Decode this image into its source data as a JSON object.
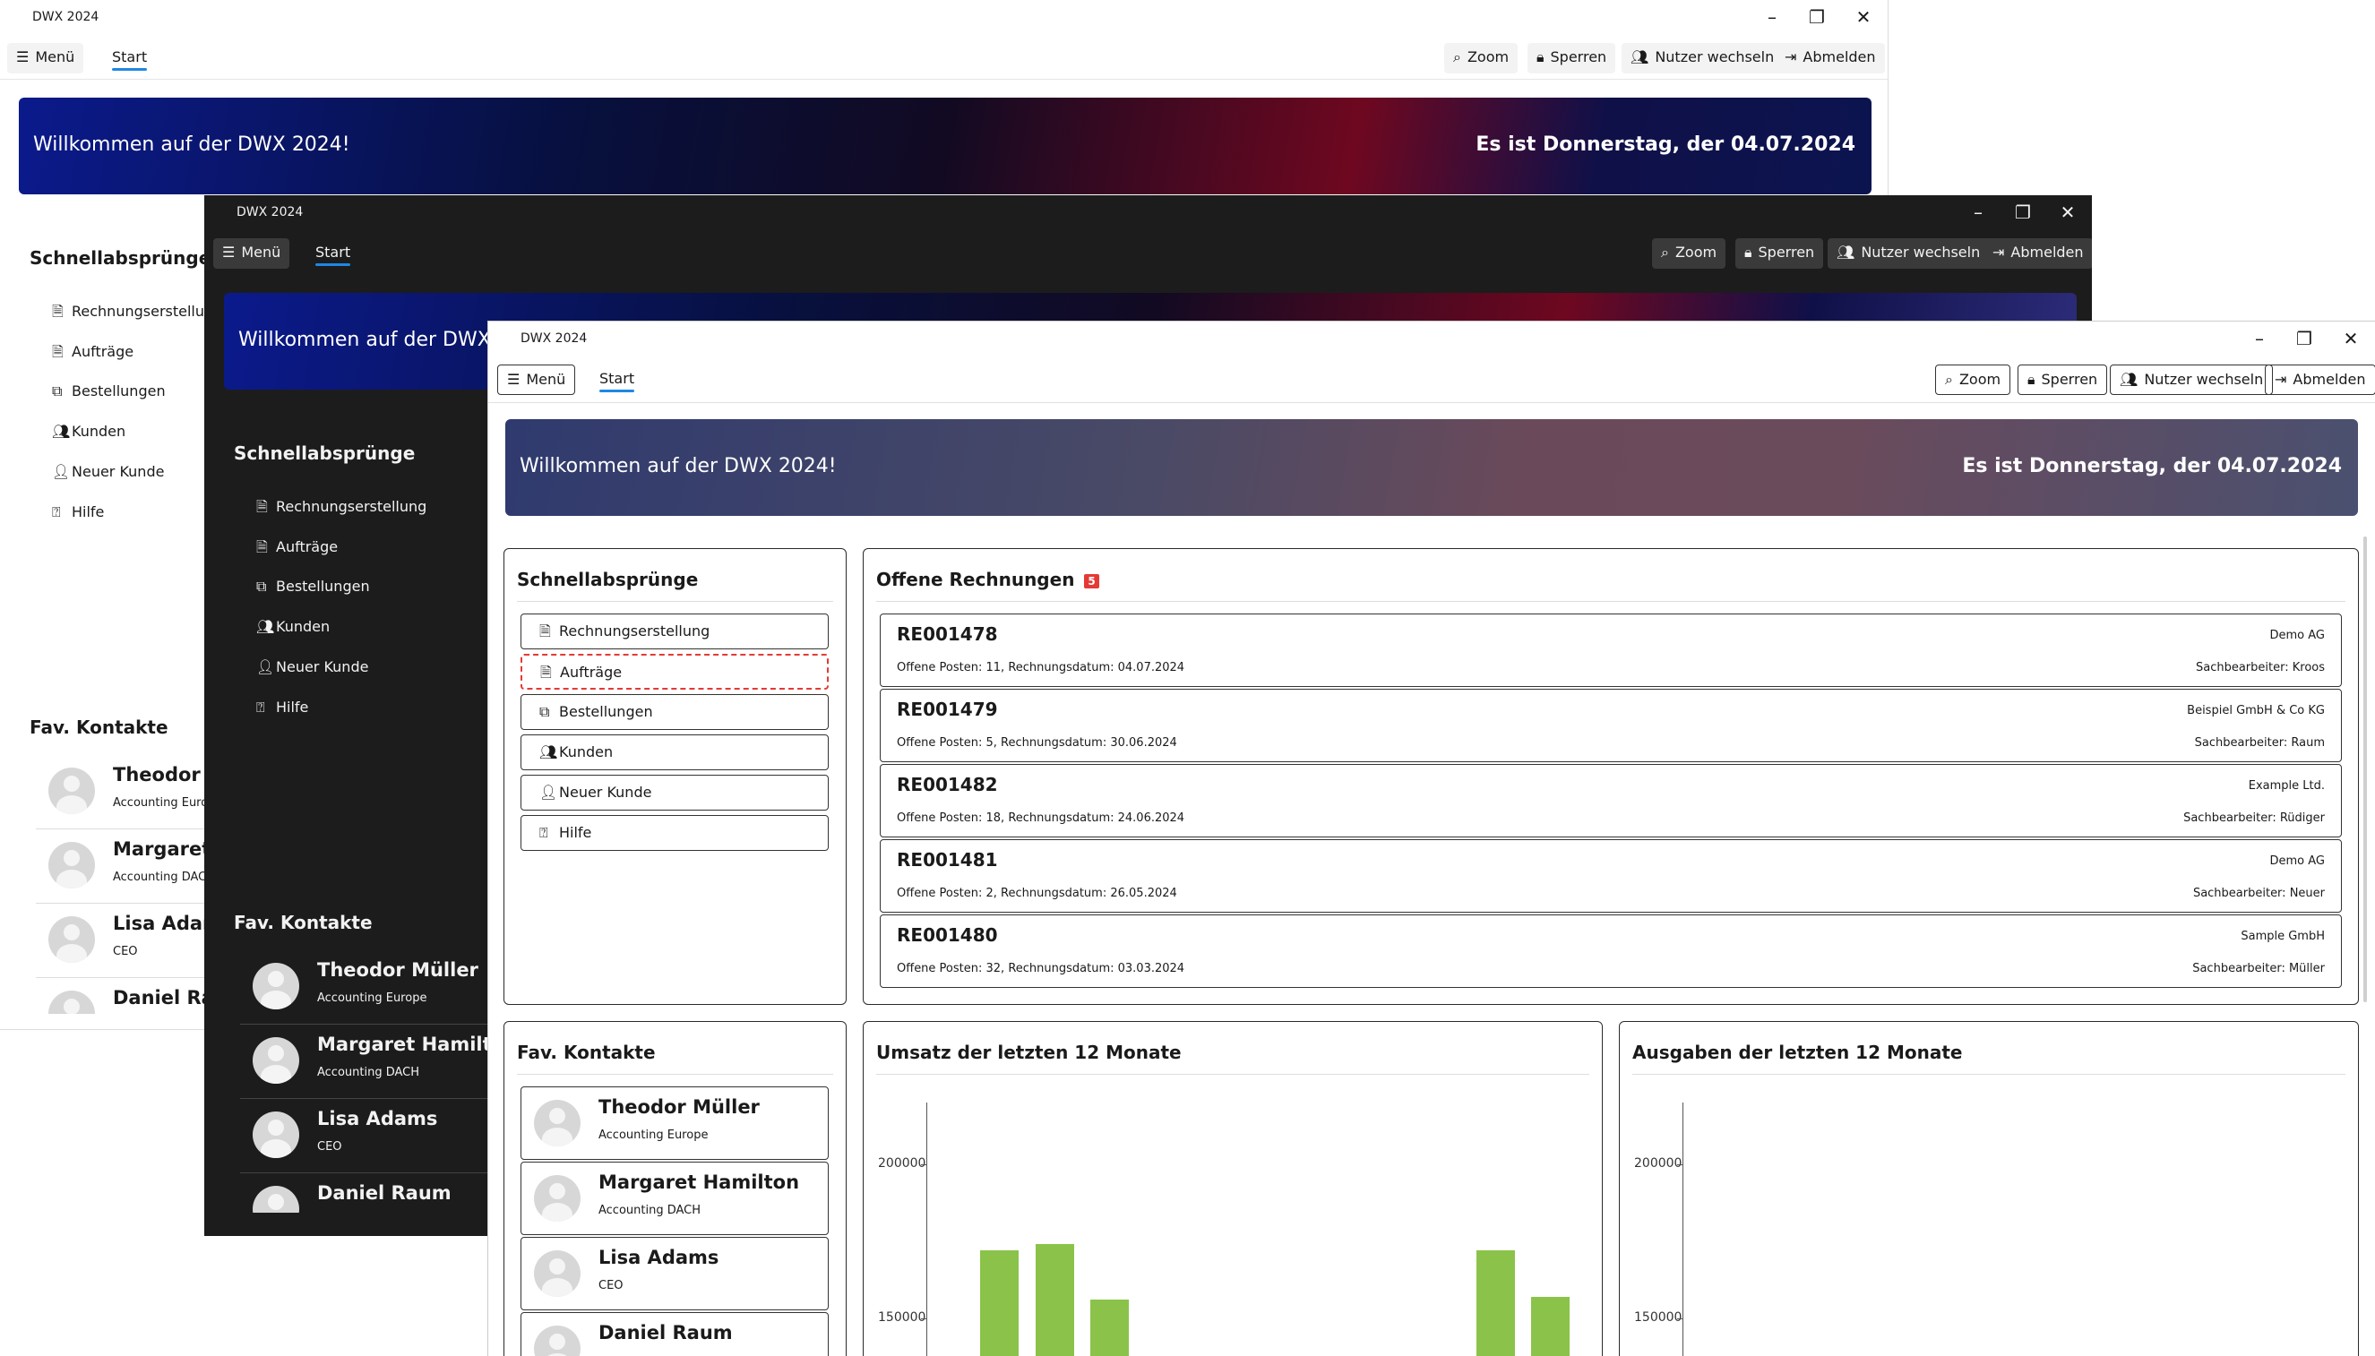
{
  "app_title": "DWX 2024",
  "menu_label": "Menü",
  "tab_start": "Start",
  "toolbar": {
    "zoom": "Zoom",
    "lock": "Sperren",
    "switch_user": "Nutzer wechseln",
    "logout": "Abmelden"
  },
  "banner": {
    "welcome": "Willkommen auf der DWX 2024!",
    "date": "Es ist Donnerstag, der 04.07.2024"
  },
  "quick_links": {
    "title": "Schnellabsprünge",
    "items": [
      {
        "label": "Rechnungserstellung",
        "icon": "document-icon"
      },
      {
        "label": "Aufträge",
        "icon": "document-icon"
      },
      {
        "label": "Bestellungen",
        "icon": "copy-icon"
      },
      {
        "label": "Kunden",
        "icon": "users-icon"
      },
      {
        "label": "Neuer Kunde",
        "icon": "user-add-icon"
      },
      {
        "label": "Hilfe",
        "icon": "help-icon"
      }
    ]
  },
  "favorites": {
    "title": "Fav. Kontakte",
    "items": [
      {
        "name": "Theodor Müller",
        "role": "Accounting Europe"
      },
      {
        "name": "Margaret Hamilton",
        "role": "Accounting DACH"
      },
      {
        "name": "Lisa Adams",
        "role": "CEO"
      },
      {
        "name": "Daniel Raum",
        "role": ""
      }
    ]
  },
  "invoices": {
    "title": "Offene Rechnungen",
    "badge": "5",
    "items": [
      {
        "id": "RE001478",
        "details": "Offene Posten: 11, Rechnungsdatum: 04.07.2024",
        "customer": "Demo AG",
        "clerk": "Sachbearbeiter: Kroos"
      },
      {
        "id": "RE001479",
        "details": "Offene Posten: 5, Rechnungsdatum: 30.06.2024",
        "customer": "Beispiel GmbH & Co KG",
        "clerk": "Sachbearbeiter: Raum"
      },
      {
        "id": "RE001482",
        "details": "Offene Posten: 18, Rechnungsdatum: 24.06.2024",
        "customer": "Example Ltd.",
        "clerk": "Sachbearbeiter: Rüdiger"
      },
      {
        "id": "RE001481",
        "details": "Offene Posten: 2, Rechnungsdatum: 26.05.2024",
        "customer": "Demo AG",
        "clerk": "Sachbearbeiter: Neuer"
      },
      {
        "id": "RE001480",
        "details": "Offene Posten: 32, Rechnungsdatum: 03.03.2024",
        "customer": "Sample GmbH",
        "clerk": "Sachbearbeiter: Müller"
      }
    ]
  },
  "colors": {
    "accent": "#1e88e5",
    "bar": "#8bc34a",
    "badge": "#e53935",
    "dark_bg": "#1c1c1c"
  },
  "chart_data": [
    {
      "type": "bar",
      "title": "Umsatz der letzten 12 Monate",
      "yticks": [
        150000,
        200000
      ],
      "y_visible_range": [
        130000,
        220000
      ],
      "values": [
        172000,
        174000,
        156000,
        null,
        null,
        null,
        null,
        null,
        null,
        172000,
        157000,
        null
      ],
      "note_visible": "partial view, bars cut off at bottom"
    },
    {
      "type": "bar",
      "title": "Ausgaben der letzten 12 Monate",
      "yticks": [
        150000,
        200000
      ],
      "y_visible_range": [
        130000,
        220000
      ],
      "values": []
    }
  ]
}
